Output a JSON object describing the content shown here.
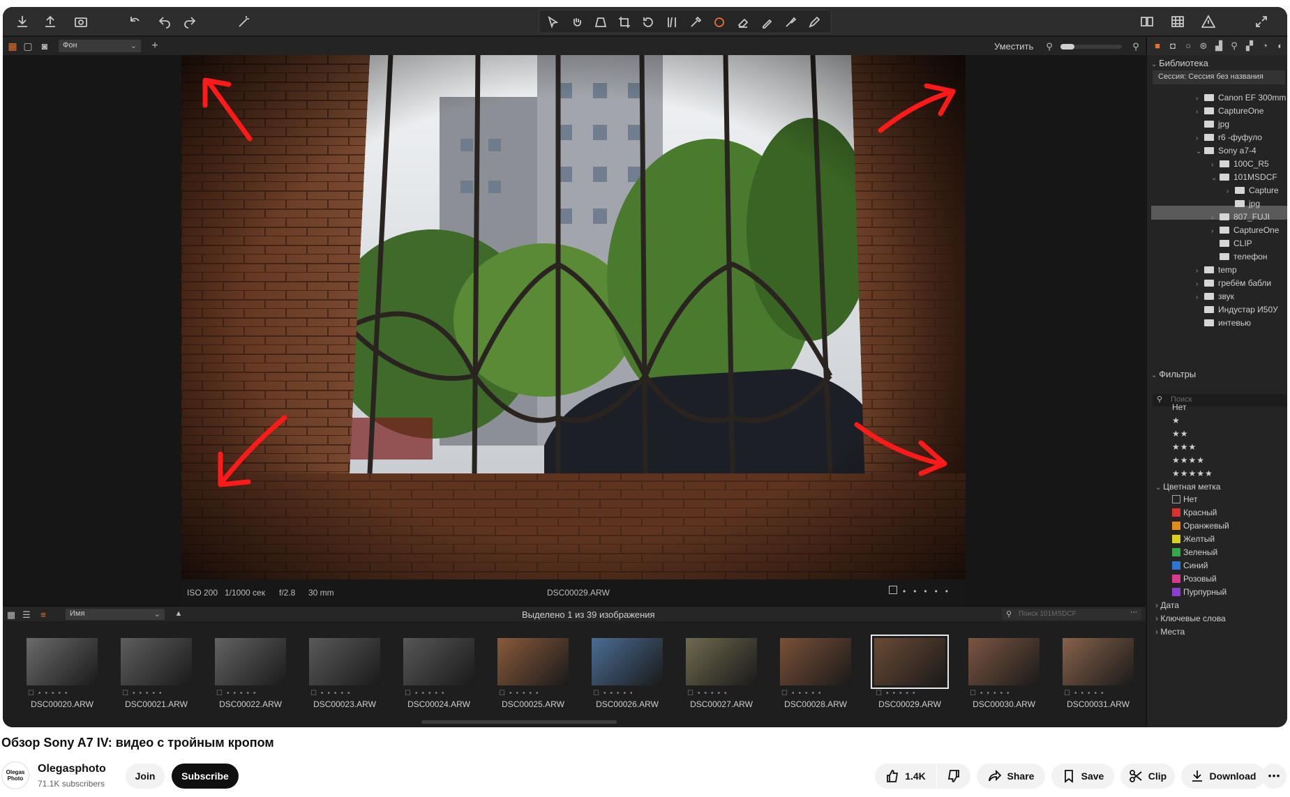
{
  "toolbar": {
    "icons": [
      "download-icon",
      "upload-icon",
      "camera-icon",
      "undo-all-icon",
      "undo-icon",
      "redo-icon",
      "magic-wand-icon"
    ]
  },
  "subbar": {
    "view_select": "Фон",
    "fit_label": "Уместить"
  },
  "viewer": {
    "iso": "ISO 200",
    "shutter": "1/1000 сек",
    "aperture": "f/2.8",
    "focal": "30 mm",
    "filename": "DSC00029.ARW"
  },
  "filmstrip_bar": {
    "sort_select": "Имя",
    "selection_text": "Выделено 1 из 39 изображения",
    "search_placeholder": "Поиск 101MSDCF"
  },
  "filmstrip": {
    "thumbs": [
      {
        "name": "DSC00020.ARW",
        "tone": "#6b6b6b"
      },
      {
        "name": "DSC00021.ARW",
        "tone": "#5e5e5e"
      },
      {
        "name": "DSC00022.ARW",
        "tone": "#636363"
      },
      {
        "name": "DSC00023.ARW",
        "tone": "#5a5a5a"
      },
      {
        "name": "DSC00024.ARW",
        "tone": "#575757"
      },
      {
        "name": "DSC00025.ARW",
        "tone": "#8a5a3b"
      },
      {
        "name": "DSC00026.ARW",
        "tone": "#4b6d93"
      },
      {
        "name": "DSC00027.ARW",
        "tone": "#6f6a4e"
      },
      {
        "name": "DSC00028.ARW",
        "tone": "#7a5038"
      },
      {
        "name": "DSC00029.ARW",
        "tone": "#6a4a34"
      },
      {
        "name": "DSC00030.ARW",
        "tone": "#7b5642"
      },
      {
        "name": "DSC00031.ARW",
        "tone": "#86624a"
      }
    ],
    "selected_index": 9
  },
  "panel": {
    "library_title": "Библиотека",
    "session": "Сессия: Сессия без названия",
    "tree": [
      {
        "label": "Canon EF 300mm",
        "indent": 0,
        "chev": "›"
      },
      {
        "label": "CaptureOne",
        "indent": 0,
        "chev": "›"
      },
      {
        "label": "jpg",
        "indent": 0,
        "chev": ""
      },
      {
        "label": "r6 -фуфуло",
        "indent": 0,
        "chev": "›"
      },
      {
        "label": "Sony a7-4",
        "indent": 0,
        "chev": "⌄"
      },
      {
        "label": "100C_R5",
        "indent": 1,
        "chev": "›"
      },
      {
        "label": "101MSDCF",
        "indent": 1,
        "chev": "⌄"
      },
      {
        "label": "Capture",
        "indent": 2,
        "chev": "›"
      },
      {
        "label": "jpg",
        "indent": 2,
        "chev": ""
      },
      {
        "label": "807_FUJI",
        "indent": 1,
        "chev": "›"
      },
      {
        "label": "CaptureOne",
        "indent": 1,
        "chev": "›"
      },
      {
        "label": "CLIP",
        "indent": 1,
        "chev": ""
      },
      {
        "label": "телефон",
        "indent": 1,
        "chev": ""
      },
      {
        "label": "temp",
        "indent": 0,
        "chev": "›"
      },
      {
        "label": "гребём бабли",
        "indent": 0,
        "chev": "›"
      },
      {
        "label": "звук",
        "indent": 0,
        "chev": "›"
      },
      {
        "label": "Индустар И50У",
        "indent": 0,
        "chev": ""
      },
      {
        "label": "интевью",
        "indent": 0,
        "chev": ""
      }
    ],
    "filters_title": "Фильтры",
    "filter_search_placeholder": "Поиск",
    "rating_none": "Нет",
    "ratings": [
      "★",
      "★★",
      "★★★",
      "★★★★",
      "★★★★★"
    ],
    "color_label_title": "Цветная метка",
    "colors": [
      {
        "label": "Нет",
        "color": "none"
      },
      {
        "label": "Красный",
        "color": "#d9322b"
      },
      {
        "label": "Оранжевый",
        "color": "#e38a1c"
      },
      {
        "label": "Желтый",
        "color": "#d9d21c"
      },
      {
        "label": "Зеленый",
        "color": "#34a84a"
      },
      {
        "label": "Синий",
        "color": "#2f76d2"
      },
      {
        "label": "Розовый",
        "color": "#d83a8f"
      },
      {
        "label": "Пурпурный",
        "color": "#8b3fd2"
      }
    ],
    "bottom_sections": [
      "Дата",
      "Ключевые слова",
      "Места"
    ]
  },
  "youtube": {
    "title": "Обзор Sony A7 IV: видео с тройным кропом",
    "channel": "Olegasphoto",
    "avatar_text": "Olegas Photo",
    "subscribers": "71.1K subscribers",
    "join": "Join",
    "subscribe": "Subscribe",
    "likes": "1.4K",
    "share": "Share",
    "save": "Save",
    "clip": "Clip",
    "download": "Download"
  },
  "colors": {
    "accent": "#e8712a",
    "arrow": "#ff1a1a"
  }
}
